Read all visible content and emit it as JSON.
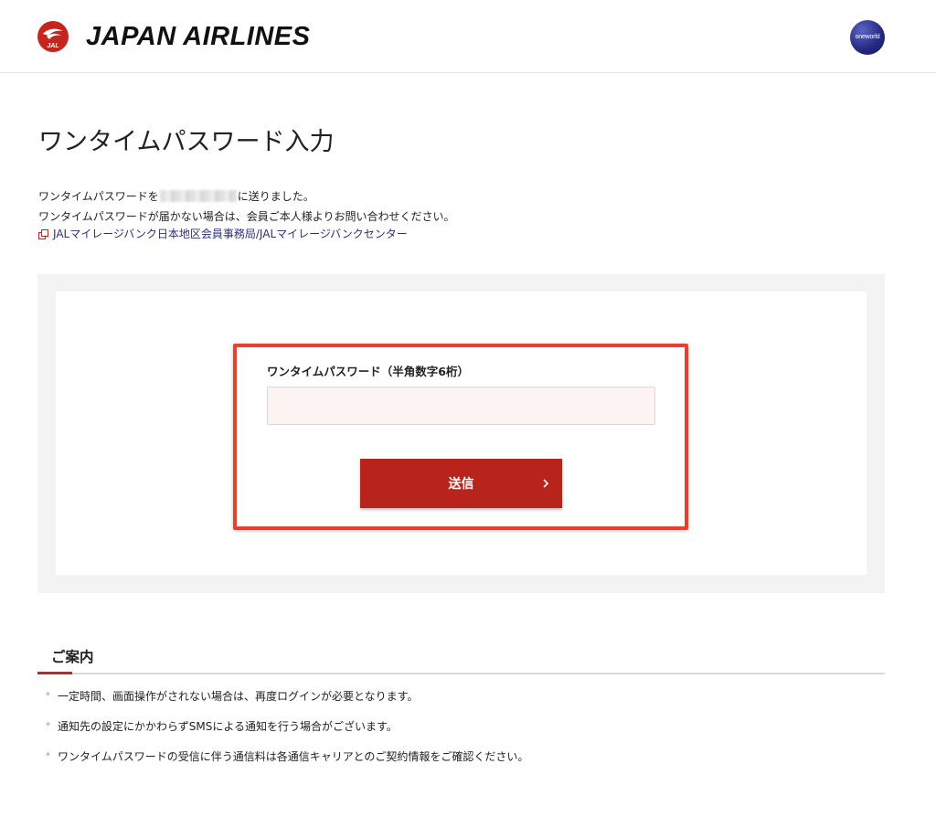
{
  "header": {
    "brand": "JAPAN AIRLINES",
    "logo_text": "JAL",
    "alliance_badge": "oneworld",
    "colors": {
      "brand_red": "#c4261d"
    }
  },
  "main": {
    "title": "ワンタイムパスワード入力",
    "desc_line1_prefix": "ワンタイムパスワードを",
    "desc_line1_suffix": "に送りました。",
    "desc_line2": "ワンタイムパスワードが届かない場合は、会員ご本人様よりお問い合わせください。",
    "help_link": "JALマイレージバンク日本地区会員事務局/JALマイレージバンクセンター",
    "link_icon": "external-link-icon"
  },
  "form": {
    "otp_label": "ワンタイムパスワード（半角数字6桁）",
    "otp_value": "",
    "submit_label": "送信",
    "submit_icon": "chevron-right-icon",
    "colors": {
      "button": "#b8231b",
      "highlight": "#e8402e",
      "input_bg": "#fdf3f3"
    }
  },
  "guide": {
    "title": "ご案内",
    "bullet": "*",
    "items": [
      "一定時間、画面操作がされない場合は、再度ログインが必要となります。",
      "通知先の設定にかかわらずSMSによる通知を行う場合がございます。",
      "ワンタイムパスワードの受信に伴う通信料は各通信キャリアとのご契約情報をご確認ください。"
    ]
  }
}
